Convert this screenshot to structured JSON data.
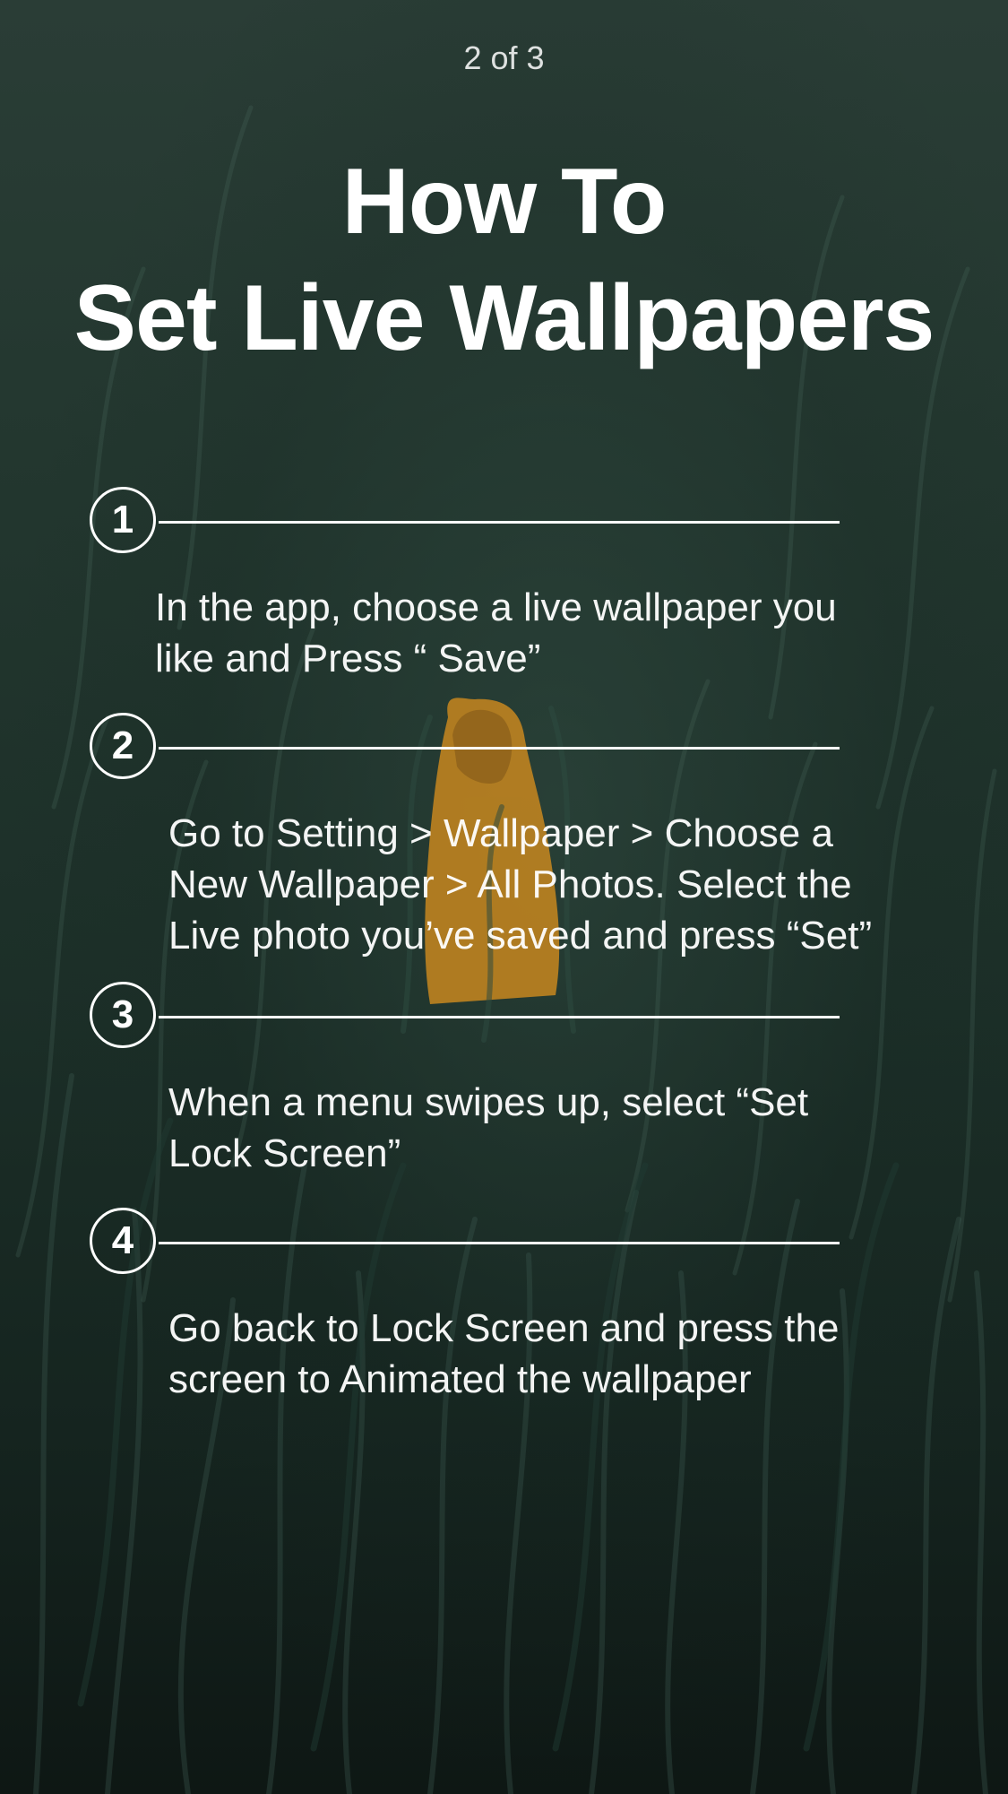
{
  "page_counter": "2 of 3",
  "title": {
    "line1": "How To",
    "line2": "Set Live Wallpapers"
  },
  "steps": [
    {
      "number": "1",
      "text_line1": "In the app, choose a live wallpaper you",
      "text_line2": "like and Press “ Save”",
      "text_line3": ""
    },
    {
      "number": "2",
      "text_line1": "Go to Setting > Wallpaper > Choose a",
      "text_line2": "New Wallpaper > All Photos. Select the",
      "text_line3": "Live photo you’ve saved and press “Set”"
    },
    {
      "number": "3",
      "text_line1": "When a menu swipes up, select “Set",
      "text_line2": "Lock Screen”",
      "text_line3": ""
    },
    {
      "number": "4",
      "text_line1": "Go back to Lock Screen and press the",
      "text_line2": "screen to Animated the wallpaper",
      "text_line3": ""
    }
  ],
  "colors": {
    "text": "#ffffff",
    "background_dark": "#15241f",
    "background_mid": "#2a3d36",
    "figure_accent": "#c8871f"
  }
}
